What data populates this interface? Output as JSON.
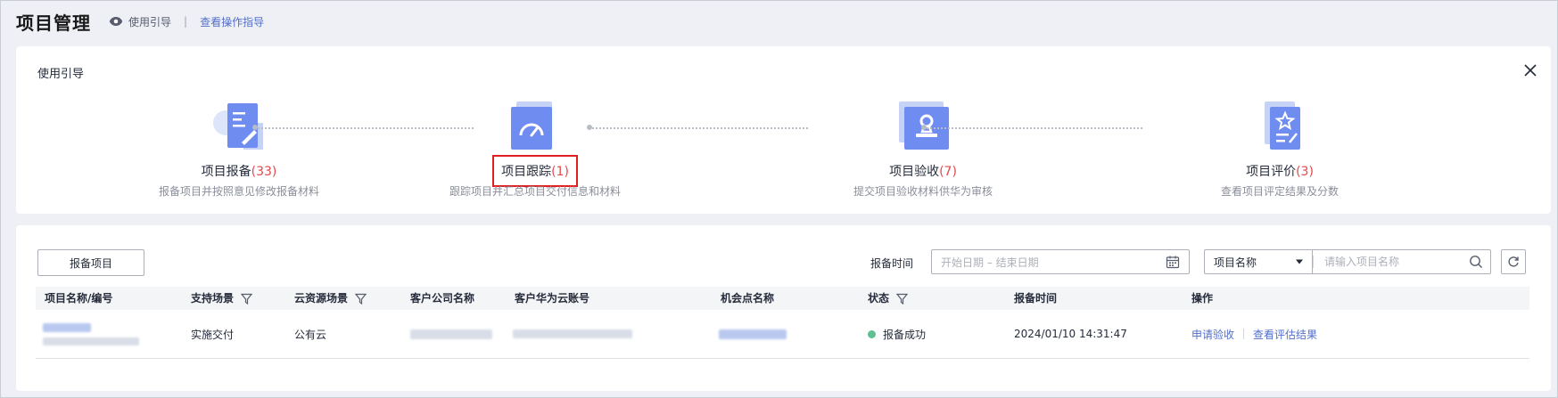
{
  "header": {
    "title": "项目管理",
    "guide_label": "使用引导",
    "separator": "|",
    "link_label": "查看操作指导"
  },
  "guide": {
    "title": "使用引导",
    "steps": [
      {
        "label": "项目报备",
        "count": "(33)",
        "desc": "报备项目并按照意见修改报备材料",
        "icon": "document-edit-icon"
      },
      {
        "label": "项目跟踪",
        "count": "(1)",
        "desc": "跟踪项目并汇总项目交付信息和材料",
        "icon": "gauge-icon"
      },
      {
        "label": "项目验收",
        "count": "(7)",
        "desc": "提交项目验收材料供华为审核",
        "icon": "stamp-icon"
      },
      {
        "label": "项目评价",
        "count": "(3)",
        "desc": "查看项目评定结果及分数",
        "icon": "star-document-icon"
      }
    ]
  },
  "toolbar": {
    "report_button": "报备项目",
    "time_label": "报备时间",
    "date_placeholder": "开始日期 – 结束日期",
    "select_value": "项目名称",
    "search_placeholder": "请输入项目名称"
  },
  "table": {
    "columns": [
      "项目名称/编号",
      "支持场景",
      "云资源场景",
      "客户公司名称",
      "客户华为云账号",
      "机会点名称",
      "状态",
      "报备时间",
      "操作"
    ],
    "rows": [
      {
        "scene": "实施交付",
        "cloud_scene": "公有云",
        "status": "报备成功",
        "time": "2024/01/10 14:31:47",
        "actions": [
          "申请验收",
          "查看评估结果"
        ]
      }
    ]
  },
  "colors": {
    "accent": "#526ecc",
    "count": "#e5484d",
    "success": "#5ec290",
    "highlight_box": "#e02020"
  }
}
